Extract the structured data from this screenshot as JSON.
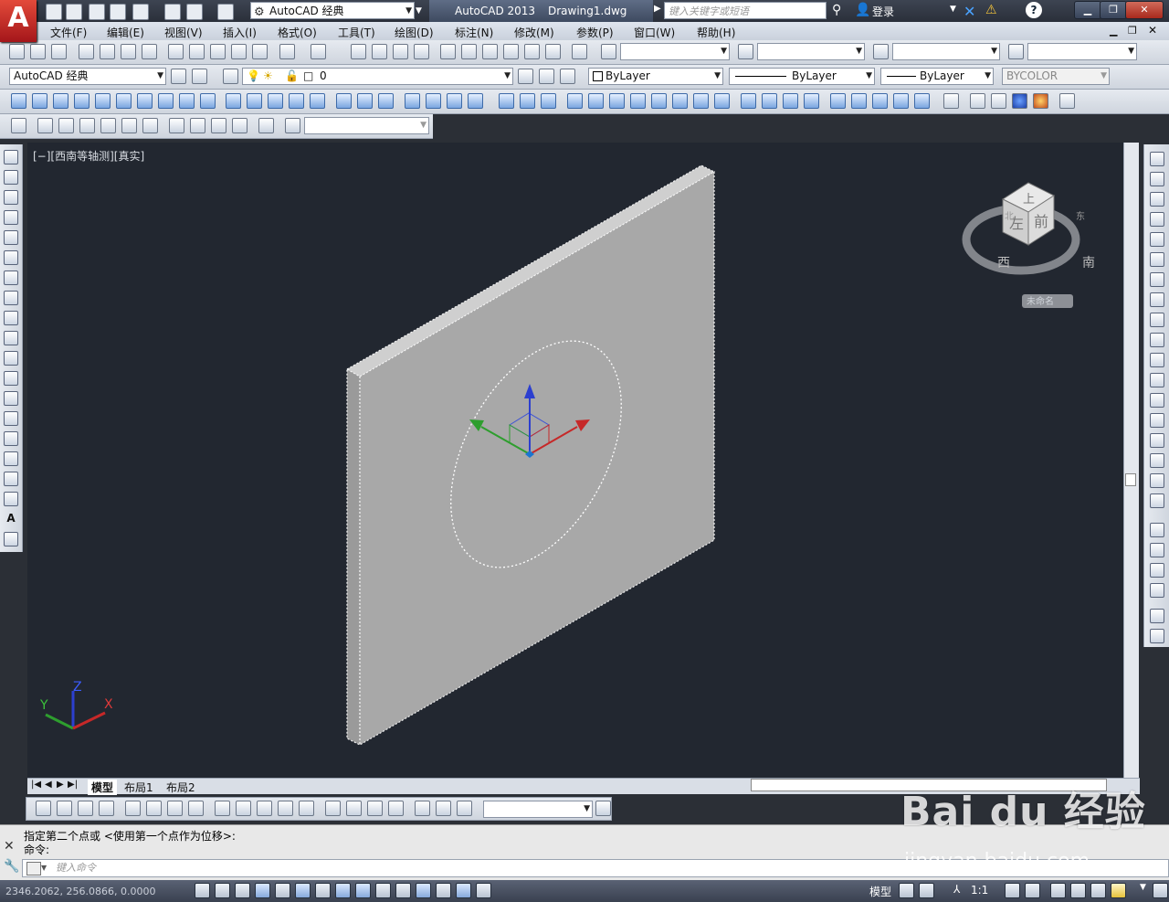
{
  "app": {
    "logo_letter": "A",
    "title_app": "AutoCAD 2013",
    "title_file": "Drawing1.dwg",
    "workspace": "AutoCAD 经典",
    "search_placeholder": "键入关键字或短语",
    "login": "登录"
  },
  "menu": [
    "文件(F)",
    "编辑(E)",
    "视图(V)",
    "插入(I)",
    "格式(O)",
    "工具(T)",
    "绘图(D)",
    "标注(N)",
    "修改(M)",
    "参数(P)",
    "窗口(W)",
    "帮助(H)"
  ],
  "toolbar2": {
    "workspace": "AutoCAD 经典",
    "layer": "0",
    "color": "ByLayer",
    "linetype": "ByLayer",
    "lineweight": "ByLayer",
    "plotstyle": "BYCOLOR"
  },
  "viewport": {
    "label": "[−][西南等轴测][真实]"
  },
  "viewcube": {
    "top": "上",
    "left": "左",
    "front": "前",
    "compass_w": "西",
    "compass_s": "南",
    "compass_n": "北",
    "compass_e": "东",
    "ucs_name": "未命名"
  },
  "ucs_axes": {
    "x": "X",
    "y": "Y",
    "z": "Z"
  },
  "tabs": [
    "模型",
    "布局1",
    "布局2"
  ],
  "command": {
    "line1": "指定第二个点或 <使用第一个点作为位移>:",
    "line2": "命令:",
    "input_placeholder": "键入命令"
  },
  "status": {
    "coords": "2346.2062, 256.0866, 0.0000",
    "model": "模型",
    "scale": "1:1"
  },
  "watermark": {
    "main": "Bai du 经验",
    "sub": "jingyan.baidu.com"
  },
  "colors": {
    "viewport_bg": "#222730",
    "slab_face": "#a8a8a8",
    "axis_x": "#c62828",
    "axis_y": "#2e9e2e",
    "axis_z": "#2c3fcf"
  }
}
